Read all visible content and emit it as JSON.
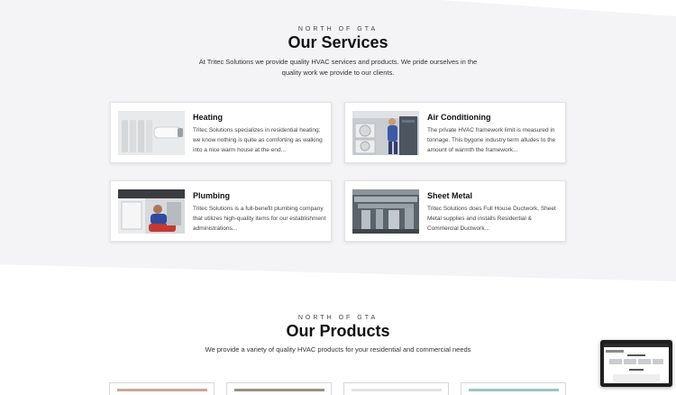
{
  "services": {
    "eyebrow": "NORTH OF GTA",
    "title": "Our Services",
    "intro": "At Tritec Solutions we provide quality HVAC services and products. We pride ourselves in the quality work we provide to our clients.",
    "cards": [
      {
        "title": "Heating",
        "text": "Tritec Solutions specializes in residential heating; we know nothing is quite as comforting as walking into a nice warm house at the end...",
        "image": "radiator-thermostat-photo"
      },
      {
        "title": "Air Conditioning",
        "text": "The private HVAC framework limit is measured in tonnage. This bygone industry term alludes to the amount of warmth the framework...",
        "image": "ac-technician-photo"
      },
      {
        "title": "Plumbing",
        "text": "Tritec Solutions is a full-benefit plumbing company that utilizes high-quality items for our establishment administrations...",
        "image": "plumber-under-sink-photo"
      },
      {
        "title": "Sheet Metal",
        "text": "Tritec Solutions does Full House Ductwork, Sheet Metal supplies and installs Residential & Commercial Ductwork...",
        "image": "ductwork-photo"
      }
    ]
  },
  "products": {
    "eyebrow": "NORTH OF GTA",
    "title": "Our Products",
    "intro": "We provide a variety of quality HVAC products for your residential and commercial needs"
  },
  "colors": {
    "section_bg": "#f4f4f6",
    "accent": "#b6513a"
  }
}
